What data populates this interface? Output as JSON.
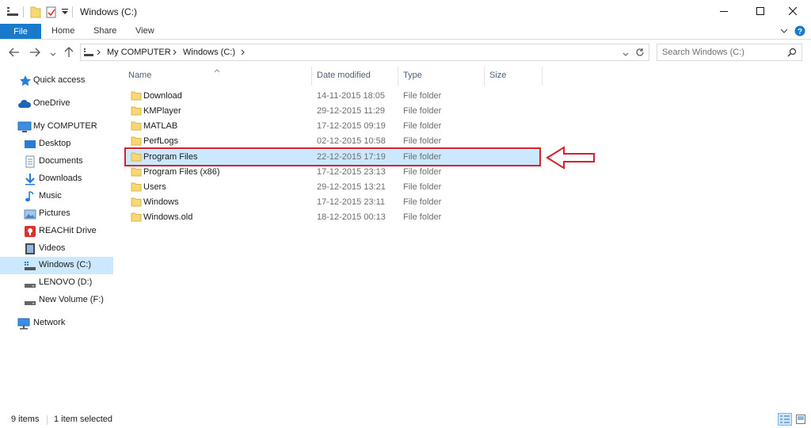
{
  "window": {
    "title": "Windows (C:)",
    "controls": [
      "minimize-icon",
      "maximize-icon",
      "close-icon"
    ]
  },
  "ribbon": {
    "tabs": [
      {
        "label": "File",
        "active": true
      },
      {
        "label": "Home"
      },
      {
        "label": "Share"
      },
      {
        "label": "View"
      }
    ]
  },
  "address": {
    "breadcrumb": [
      "My COMPUTER",
      "Windows (C:)"
    ]
  },
  "search": {
    "placeholder": "Search Windows (C:)"
  },
  "sidebar": {
    "items": [
      {
        "label": "Quick access",
        "icon": "star-icon"
      },
      {
        "label": "OneDrive",
        "icon": "cloud-icon"
      },
      {
        "label": "My COMPUTER",
        "icon": "computer-icon"
      },
      {
        "label": "Desktop",
        "icon": "desktop-icon"
      },
      {
        "label": "Documents",
        "icon": "documents-icon"
      },
      {
        "label": "Downloads",
        "icon": "download-icon"
      },
      {
        "label": "Music",
        "icon": "music-icon"
      },
      {
        "label": "Pictures",
        "icon": "pictures-icon"
      },
      {
        "label": "REACHit Drive",
        "icon": "reachit-drive-icon"
      },
      {
        "label": "Videos",
        "icon": "videos-icon"
      },
      {
        "label": "Windows (C:)",
        "icon": "system-drive-icon",
        "selected": true
      },
      {
        "label": "LENOVO (D:)",
        "icon": "drive-icon"
      },
      {
        "label": "New Volume (F:)",
        "icon": "drive-icon"
      },
      {
        "label": "Network",
        "icon": "network-icon"
      }
    ]
  },
  "columns": {
    "name": "Name",
    "date": "Date modified",
    "type": "Type",
    "size": "Size"
  },
  "files": [
    {
      "name": "Download",
      "date": "14-11-2015 18:05",
      "type": "File folder"
    },
    {
      "name": "KMPlayer",
      "date": "29-12-2015 11:29",
      "type": "File folder"
    },
    {
      "name": "MATLAB",
      "date": "17-12-2015 09:19",
      "type": "File folder"
    },
    {
      "name": "PerfLogs",
      "date": "02-12-2015 10:58",
      "type": "File folder"
    },
    {
      "name": "Program Files",
      "date": "22-12-2015 17:19",
      "type": "File folder",
      "selected": true
    },
    {
      "name": "Program Files (x86)",
      "date": "17-12-2015 23:13",
      "type": "File folder"
    },
    {
      "name": "Users",
      "date": "29-12-2015 13:21",
      "type": "File folder"
    },
    {
      "name": "Windows",
      "date": "17-12-2015 23:11",
      "type": "File folder"
    },
    {
      "name": "Windows.old",
      "date": "18-12-2015 00:13",
      "type": "File folder"
    }
  ],
  "status": {
    "item_count": "9 items",
    "selection": "1 item selected"
  },
  "colors": {
    "accent": "#1979ca",
    "selection": "#cce8ff",
    "annotation": "#d7202b",
    "folder": "#f8d775"
  }
}
